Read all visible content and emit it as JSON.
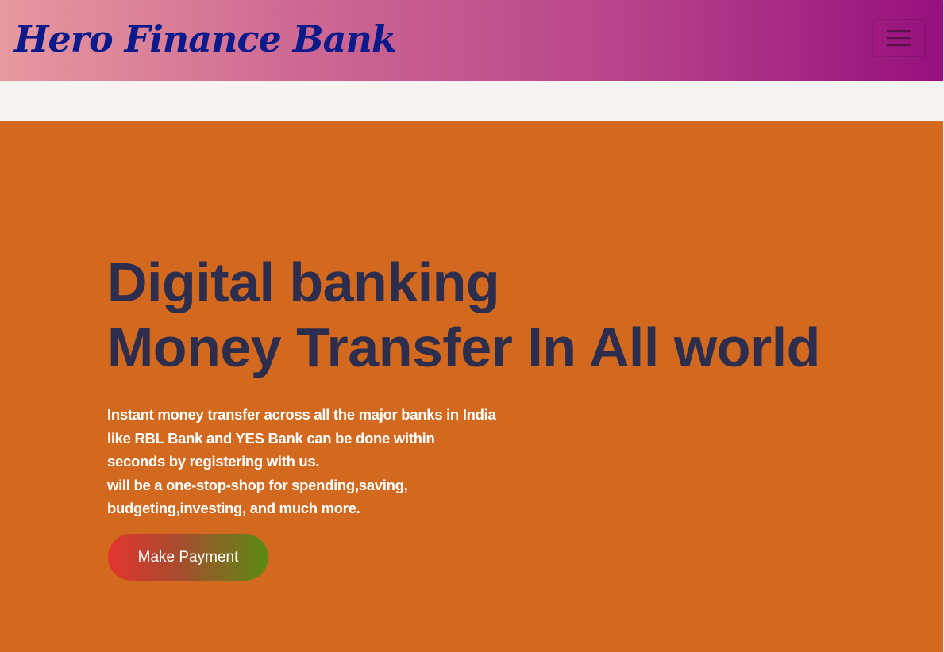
{
  "navbar": {
    "brand": "Hero Finance Bank",
    "menu_icon": "hamburger-menu-icon"
  },
  "hero": {
    "title_line1": "Digital banking",
    "title_line2": "Money Transfer In All world",
    "description_lines": [
      "Instant money transfer across all the major banks in India",
      "like RBL Bank and YES Bank can be done within",
      "seconds by registering with us.",
      "will be a one-stop-shop for spending,saving,",
      "budgeting,investing, and much more."
    ],
    "button_label": "Make Payment"
  },
  "colors": {
    "navbar_gradient_start": "#e7999f",
    "navbar_gradient_end": "#96107e",
    "brand_text": "#0a1a8a",
    "hero_background": "#d2691e",
    "hero_title": "#2d2d4e",
    "button_gradient_start": "#e3342f",
    "button_gradient_end": "#5a8c12"
  }
}
